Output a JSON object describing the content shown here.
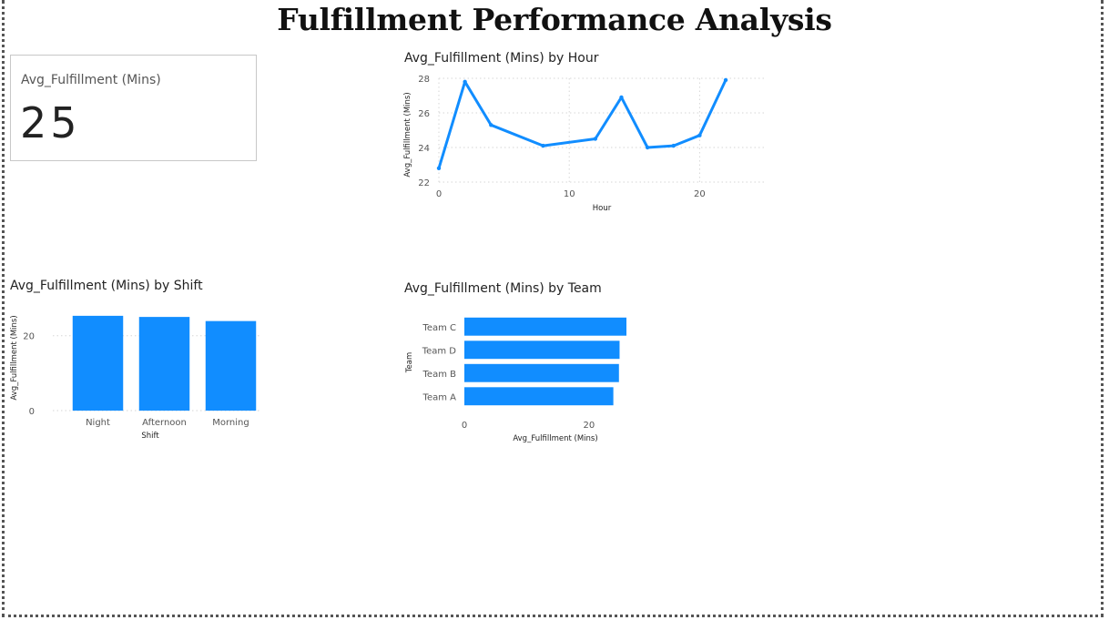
{
  "page": {
    "title": "Fulfillment Performance Analysis"
  },
  "kpi": {
    "label": "Avg_Fulfillment (Mins)",
    "value": "25"
  },
  "colors": {
    "bar": "#118DFF",
    "line": "#118DFF",
    "grid": "#d6d6d6",
    "accent_blue": "#118DFF"
  },
  "chart_data": [
    {
      "type": "line",
      "title": "Avg_Fulfillment (Mins) by Hour",
      "xlabel": "Hour",
      "ylabel": "Avg_Fulfillment (Mins)",
      "x": [
        0,
        2,
        4,
        8,
        12,
        14,
        16,
        18,
        20,
        22
      ],
      "y": [
        22.8,
        27.8,
        25.3,
        24.1,
        24.5,
        26.9,
        24.0,
        24.1,
        24.7,
        27.9
      ],
      "xlim": [
        0,
        25
      ],
      "ylim": [
        22,
        28
      ],
      "xticks": [
        0,
        10,
        20
      ],
      "yticks": [
        22,
        24,
        26,
        28
      ],
      "grid": true
    },
    {
      "type": "bar",
      "title": "Avg_Fulfillment (Mins) by Shift",
      "xlabel": "Shift",
      "ylabel": "Avg_Fulfillment (Mins)",
      "categories": [
        "Night",
        "Afternoon",
        "Morning"
      ],
      "values": [
        25.3,
        25.0,
        23.9
      ],
      "ylim": [
        0,
        26
      ],
      "yticks": [
        0,
        20
      ],
      "grid": true
    },
    {
      "type": "bar",
      "orientation": "horizontal",
      "title": "Avg_Fulfillment (Mins) by Team",
      "xlabel": "Avg_Fulfillment (Mins)",
      "ylabel": "Team",
      "categories": [
        "Team C",
        "Team D",
        "Team B",
        "Team A"
      ],
      "values": [
        26.0,
        24.9,
        24.8,
        23.9
      ],
      "xlim": [
        0,
        26
      ],
      "xticks": [
        0,
        20
      ],
      "grid": false
    }
  ]
}
